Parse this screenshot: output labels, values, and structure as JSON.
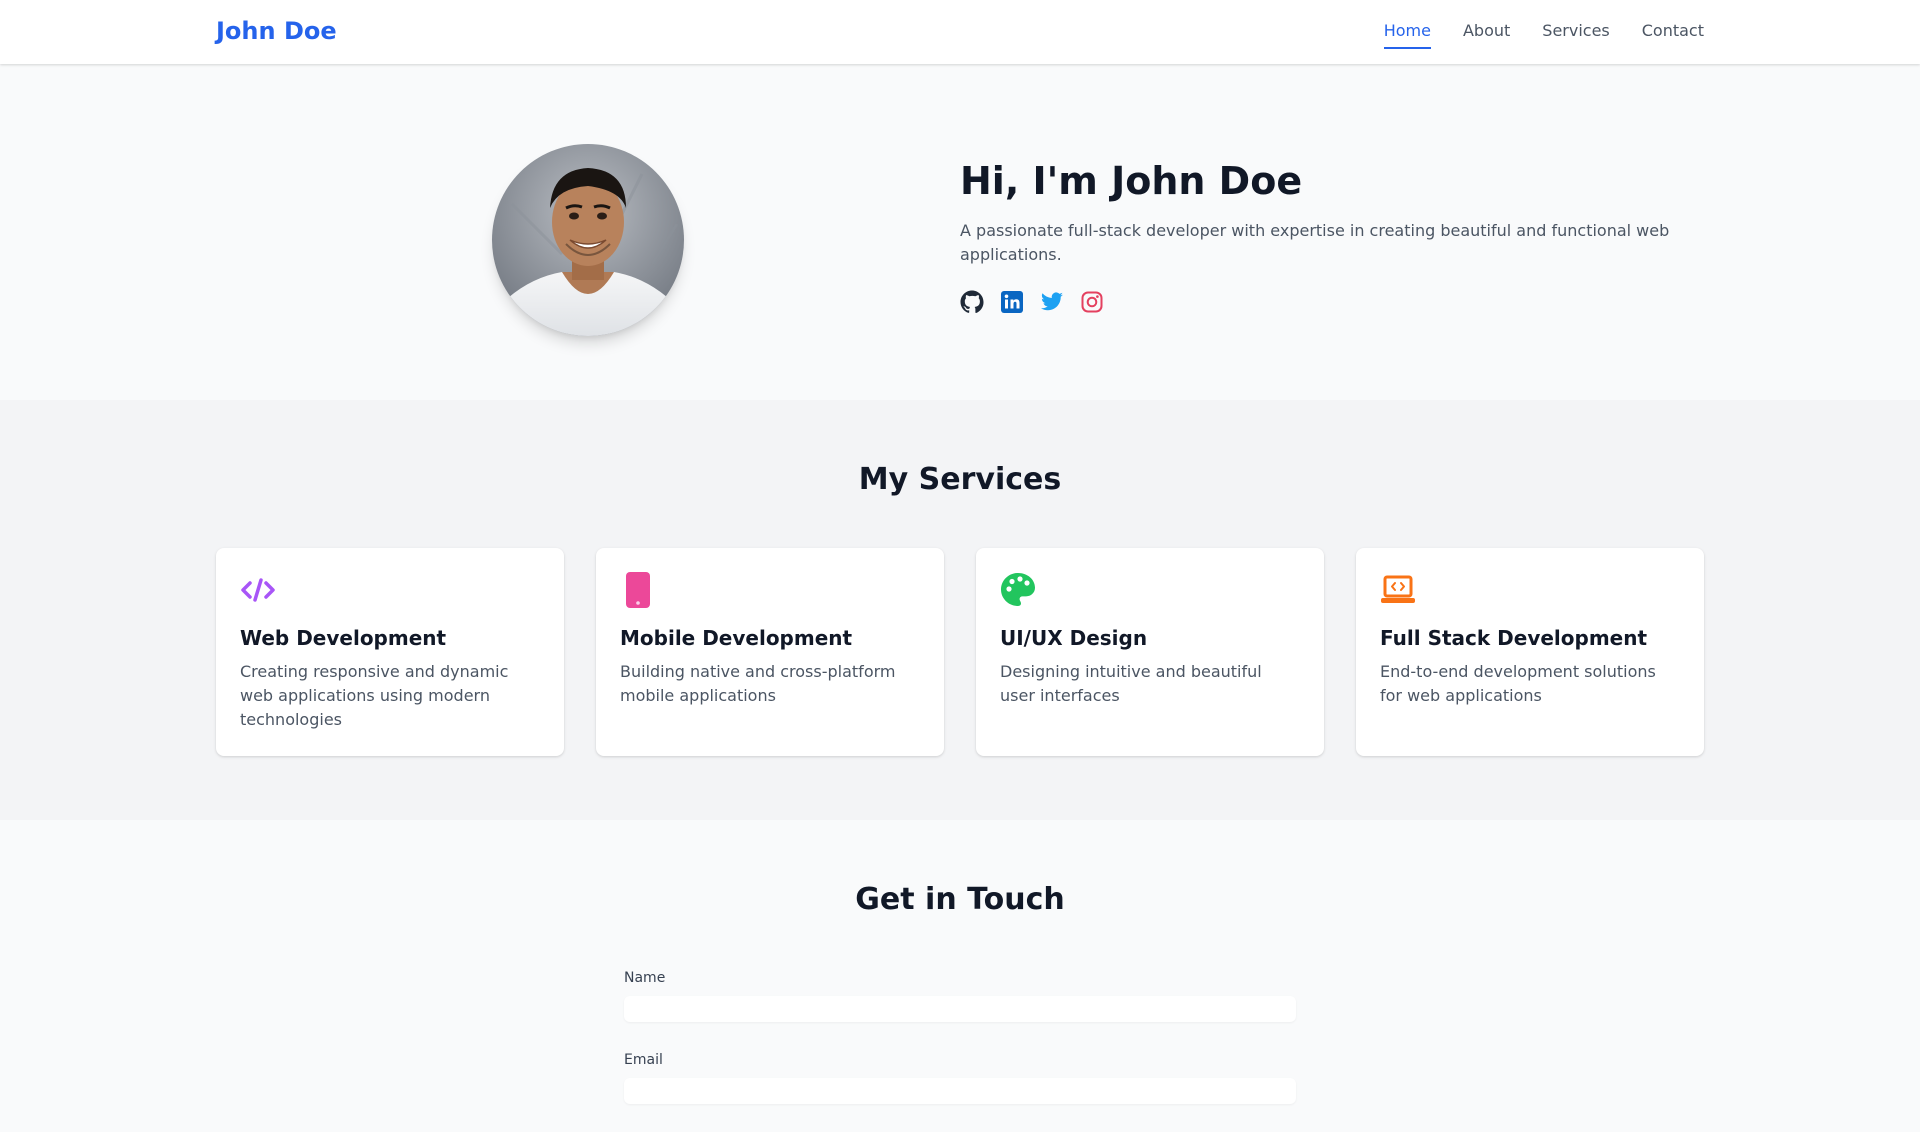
{
  "navbar": {
    "brand": "John Doe",
    "links": [
      {
        "label": "Home",
        "active": true
      },
      {
        "label": "About",
        "active": false
      },
      {
        "label": "Services",
        "active": false
      },
      {
        "label": "Contact",
        "active": false
      }
    ]
  },
  "hero": {
    "title": "Hi, I'm John Doe",
    "description": "A passionate full-stack developer with expertise in creating beautiful and functional web applications.",
    "social": [
      {
        "icon": "github-icon",
        "color": "#1f2937"
      },
      {
        "icon": "linkedin-icon",
        "color": "#0a66c2"
      },
      {
        "icon": "twitter-icon",
        "color": "#1da1f2"
      },
      {
        "icon": "instagram-icon",
        "color": "#e4405f"
      }
    ]
  },
  "services": {
    "title": "My Services",
    "items": [
      {
        "icon": "code-icon",
        "color": "#a855f7",
        "title": "Web Development",
        "description": "Creating responsive and dynamic web applications using modern technologies"
      },
      {
        "icon": "mobile-icon",
        "color": "#ec4899",
        "title": "Mobile Development",
        "description": "Building native and cross-platform mobile applications"
      },
      {
        "icon": "palette-icon",
        "color": "#22c55e",
        "title": "UI/UX Design",
        "description": "Designing intuitive and beautiful user interfaces"
      },
      {
        "icon": "laptop-code-icon",
        "color": "#f97316",
        "title": "Full Stack Development",
        "description": "End-to-end development solutions for web applications"
      }
    ]
  },
  "contact": {
    "title": "Get in Touch",
    "fields": [
      {
        "label": "Name",
        "value": "",
        "placeholder": ""
      },
      {
        "label": "Email",
        "value": "",
        "placeholder": ""
      }
    ]
  },
  "colors": {
    "brand": "#2563eb",
    "text_muted": "#4b5563",
    "section_alt": "#f3f4f6"
  }
}
